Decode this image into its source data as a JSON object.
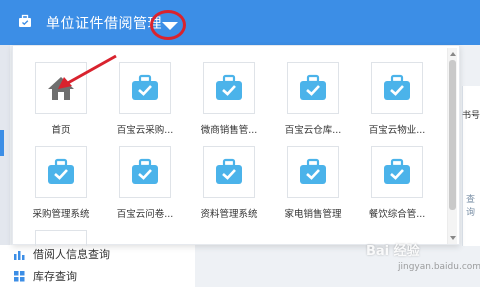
{
  "header": {
    "title": "单位证件借阅管理"
  },
  "menu_tiles": [
    {
      "label": "首页",
      "icon": "home-icon"
    },
    {
      "label": "百宝云采购...",
      "icon": "briefcase-check-icon"
    },
    {
      "label": "微商销售管...",
      "icon": "briefcase-check-icon"
    },
    {
      "label": "百宝云仓库...",
      "icon": "briefcase-check-icon"
    },
    {
      "label": "百宝云物业...",
      "icon": "briefcase-check-icon"
    },
    {
      "label": "采购管理系统",
      "icon": "briefcase-check-icon"
    },
    {
      "label": "百宝云问卷...",
      "icon": "briefcase-check-icon"
    },
    {
      "label": "资料管理系统",
      "icon": "briefcase-check-icon"
    },
    {
      "label": "家电销售管理",
      "icon": "briefcase-check-icon"
    },
    {
      "label": "餐饮综合管...",
      "icon": "briefcase-check-icon"
    }
  ],
  "background": {
    "right_text_1": "书号",
    "right_text_2": "查询",
    "bottom_menu": [
      {
        "label": "借阅人信息查询"
      },
      {
        "label": "库存查询"
      }
    ]
  },
  "watermark": {
    "text": "Bai 经验",
    "url": "jingyan.baidu.com"
  },
  "colors": {
    "accent": "#3c8ee6",
    "icon_blue": "#4bb3ea",
    "highlight_red": "#d9232e"
  }
}
